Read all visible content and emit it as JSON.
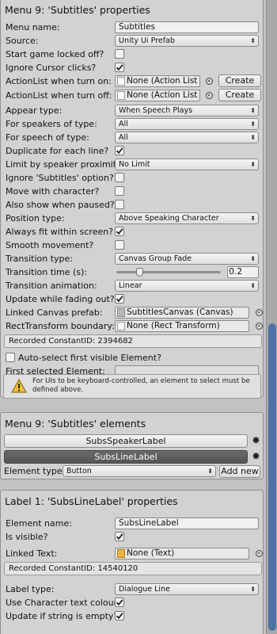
{
  "panel1": {
    "title": "Menu 9: 'Subtitles' properties",
    "menu_name_label": "Menu name:",
    "menu_name_value": "Subtitles",
    "source_label": "Source:",
    "source_value": "Unity Ui Prefab",
    "start_locked_label": "Start game locked off?",
    "start_locked_checked": false,
    "ignore_cursor_label": "Ignore Cursor clicks?",
    "ignore_cursor_checked": true,
    "al_turn_on_label": "ActionList when turn on:",
    "al_turn_on_value": "None (Action List Asset)",
    "al_turn_on_create": "Create",
    "al_turn_off_label": "ActionList when turn off:",
    "al_turn_off_value": "None (Action List Asset)",
    "al_turn_off_create": "Create",
    "appear_type_label": "Appear type:",
    "appear_type_value": "When Speech Plays",
    "speakers_type_label": "For speakers of type:",
    "speakers_type_value": "All",
    "speech_type_label": "For speech of type:",
    "speech_type_value": "All",
    "duplicate_label": "Duplicate for each line?",
    "duplicate_checked": true,
    "limit_label": "Limit by speaker proximity?",
    "limit_value": "No Limit",
    "ignore_subs_label": "Ignore 'Subtitles' option?",
    "ignore_subs_checked": false,
    "move_char_label": "Move with character?",
    "move_char_checked": false,
    "show_paused_label": "Also show when paused?",
    "show_paused_checked": false,
    "position_type_label": "Position type:",
    "position_type_value": "Above Speaking Character",
    "always_fit_label": "Always fit within screen?",
    "always_fit_checked": true,
    "smooth_label": "Smooth movement?",
    "smooth_checked": false,
    "transition_type_label": "Transition type:",
    "transition_type_value": "Canvas Group Fade",
    "transition_time_label": "Transition time (s):",
    "transition_time_value": "0.2",
    "transition_time_fraction": 0.2,
    "transition_anim_label": "Transition animation:",
    "transition_anim_value": "Linear",
    "update_fading_label": "Update while fading out?",
    "update_fading_checked": true,
    "linked_canvas_label": "Linked Canvas prefab:",
    "linked_canvas_value": "SubtitlesCanvas (Canvas)",
    "rect_boundary_label": "RectTransform boundary:",
    "rect_boundary_value": "None (Rect Transform)",
    "constant_id": "Recorded ConstantID: 2394682",
    "auto_select_label": "Auto-select first visible Element?",
    "auto_select_checked": false,
    "first_selected_label": "First selected Element:",
    "first_selected_value": "",
    "help_text": "For UIs to be keyboard-controlled, an element to select must be defined above."
  },
  "panel2": {
    "title": "Menu 9: 'Subtitles' elements",
    "elements": [
      "SubsSpeakerLabel",
      "SubsLineLabel"
    ],
    "element_type_label": "Element type",
    "element_type_value": "Button",
    "add_new": "Add new"
  },
  "panel3": {
    "title": "Label 1: 'SubsLineLabel' properties",
    "element_name_label": "Element name:",
    "element_name_value": "SubsLineLabel",
    "is_visible_label": "Is visible?",
    "is_visible_checked": true,
    "linked_text_label": "Linked Text:",
    "linked_text_value": "None (Text)",
    "constant_id": "Recorded ConstantID: 14540120",
    "label_type_label": "Label type:",
    "label_type_value": "Dialogue Line",
    "use_char_colour_label": "Use Character text colour?",
    "use_char_colour_checked": true,
    "update_empty_label": "Update if string is empty?",
    "update_empty_checked": true
  },
  "colors": {
    "scroll_thumb": "#4f71a6",
    "selected_element": "#5c5c5c",
    "panel_bg": "#d2d2d2"
  },
  "icons": [
    "gear-icon",
    "warning-icon",
    "object-picker-icon",
    "checkmark-icon",
    "dropdown-arrow-icon"
  ]
}
